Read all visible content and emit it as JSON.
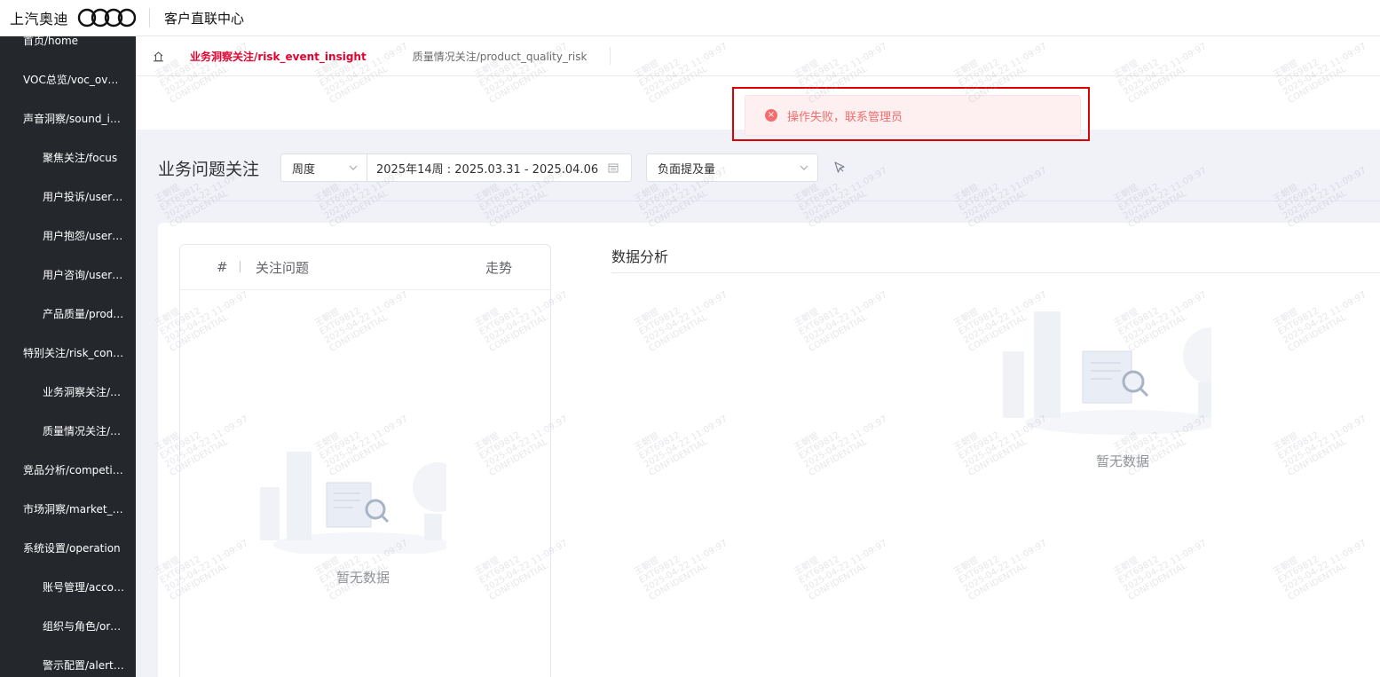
{
  "header": {
    "brand": "上汽奥迪",
    "app_title": "客户直联中心",
    "logo_icon": "audi-rings-icon"
  },
  "sidebar": {
    "items": [
      {
        "label": "首页/home",
        "level": 1
      },
      {
        "label": "VOC总览/voc_overview",
        "level": 1
      },
      {
        "label": "声音洞察/sound_insight",
        "level": 1
      },
      {
        "label": "聚焦关注/focus",
        "level": 2
      },
      {
        "label": "用户投诉/user_complaint",
        "level": 2
      },
      {
        "label": "用户抱怨/user_grumble",
        "level": 2
      },
      {
        "label": "用户咨询/user_consult",
        "level": 2
      },
      {
        "label": "产品质量/product_quality",
        "level": 2
      },
      {
        "label": "特别关注/risk_control",
        "level": 1
      },
      {
        "label": "业务洞察关注/risk_event_insight",
        "level": 2
      },
      {
        "label": "质量情况关注/product_quality_risk",
        "level": 2
      },
      {
        "label": "竞品分析/competition",
        "level": 1
      },
      {
        "label": "市场洞察/market_insight",
        "level": 1
      },
      {
        "label": "系统设置/operation",
        "level": 1
      },
      {
        "label": "账号管理/account",
        "level": 2
      },
      {
        "label": "组织与角色/organization",
        "level": 2
      },
      {
        "label": "警示配置/alert_config",
        "level": 2
      }
    ]
  },
  "tabs": {
    "home_icon": "home-icon",
    "items": [
      {
        "label": "业务洞察关注/risk_event_insight",
        "active": true
      },
      {
        "label": "质量情况关注/product_quality_risk",
        "active": false
      }
    ]
  },
  "toast": {
    "type": "error",
    "icon": "error-circle-icon",
    "message": "操作失败，联系管理员",
    "color": "#f56c6c"
  },
  "filters": {
    "page_title": "业务问题关注",
    "period_select": "周度",
    "date_range": "2025年14周 : 2025.03.31 - 2025.04.06",
    "metric_select": "负面提及量"
  },
  "issue_table": {
    "columns": [
      "#",
      "关注问题",
      "走势"
    ],
    "rows": [],
    "empty_text": "暂无数据"
  },
  "analysis": {
    "title": "数据分析",
    "empty_text": "暂无数据"
  },
  "watermark": {
    "lines": [
      "王朝锟",
      "EXT69812",
      "2025-04-22 11:09:97",
      "CONFIDENTIAL"
    ]
  },
  "colors": {
    "sidebar_bg": "#24282d",
    "accent_red": "#e6002d",
    "main_bg": "#f0f2f7",
    "highlight_frame": "#e00000"
  }
}
